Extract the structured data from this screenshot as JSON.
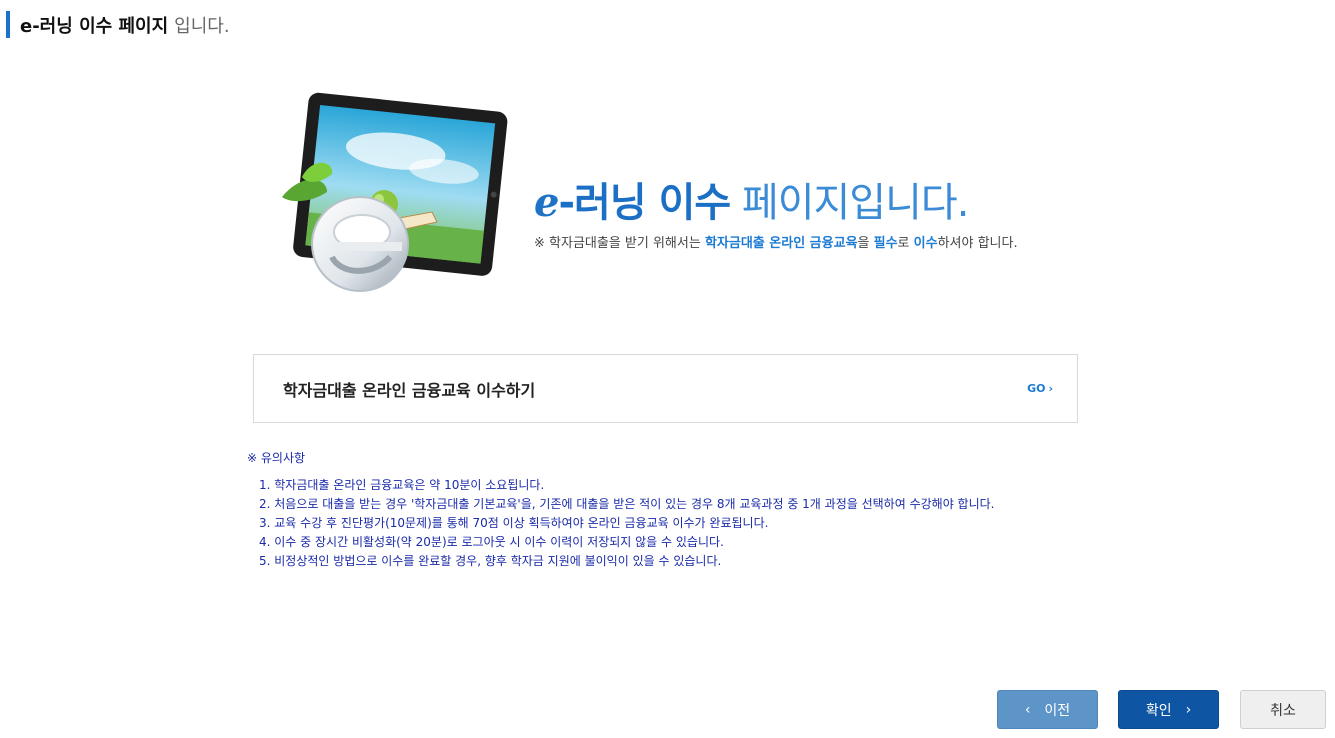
{
  "header": {
    "title_strong": "e-러닝 이수 페이지",
    "title_rest": "입니다."
  },
  "hero": {
    "title_e": "e",
    "title_bold": "-러닝 이수",
    "title_light": "페이지입니다.",
    "sub_prefix": "※ 학자금대출을 받기 위해서는 ",
    "sub_hl1": "학자금대출 온라인 금융교육",
    "sub_mid1": "을 ",
    "sub_hl2": "필수",
    "sub_mid2": "로 ",
    "sub_hl3": "이수",
    "sub_suffix": "하셔야 합니다.",
    "illustration_icon": "tablet-e-learning-illustration"
  },
  "go_box": {
    "label": "학자금대출 온라인 금융교육 이수하기",
    "link": "GO",
    "link_icon": "chevron-right-icon"
  },
  "notice": {
    "title": "※ 유의사항",
    "items": [
      "1. 학자금대출 온라인 금융교육은 약 10분이 소요됩니다.",
      "2. 처음으로 대출을 받는 경우 '학자금대출 기본교육'을, 기존에 대출을 받은 적이 있는 경우 8개 교육과정 중 1개 과정을 선택하여 수강해야 합니다.",
      "3. 교육 수강 후 진단평가(10문제)를 통해 70점 이상 획득하여야 온라인 금융교육 이수가 완료됩니다.",
      "4. 이수 중 장시간 비활성화(약 20분)로 로그아웃 시 이수 이력이 저장되지 않을 수 있습니다.",
      "5. 비정상적인 방법으로 이수를 완료할 경우, 향후 학자금 지원에 불이익이 있을 수 있습니다."
    ]
  },
  "buttons": {
    "prev": "이전",
    "ok": "확인",
    "cancel": "취소"
  },
  "colors": {
    "accent": "#1a73c9",
    "notice_text": "#1a2aa8",
    "prev_bg": "#5e95c8",
    "ok_bg": "#0e56a3"
  }
}
